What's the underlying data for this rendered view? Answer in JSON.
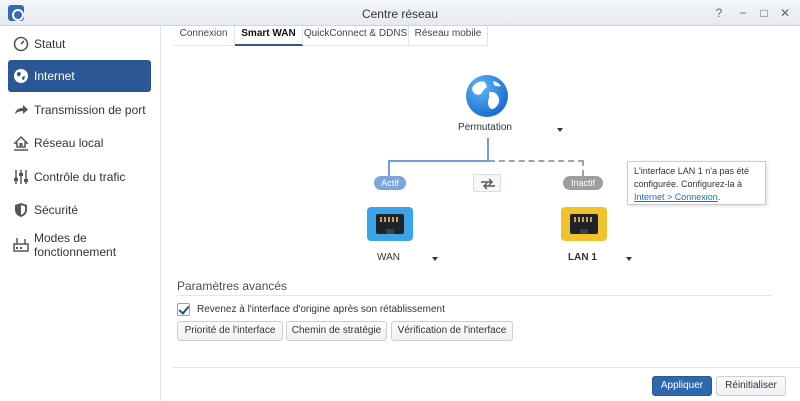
{
  "window": {
    "title": "Centre réseau",
    "help_glyph": "?",
    "minimize_glyph": "−",
    "maximize_glyph": "□",
    "close_glyph": "✕"
  },
  "sidebar": {
    "items": [
      {
        "label": "Statut",
        "icon": "gauge-icon",
        "active": false
      },
      {
        "label": "Internet",
        "icon": "globe-icon",
        "active": true
      },
      {
        "label": "Transmission de port",
        "icon": "arrow-forward-icon",
        "active": false
      },
      {
        "label": "Réseau local",
        "icon": "house-network-icon",
        "active": false
      },
      {
        "label": "Contrôle du trafic",
        "icon": "sliders-icon",
        "active": false
      },
      {
        "label": "Sécurité",
        "icon": "shield-icon",
        "active": false
      },
      {
        "label": "Modes de fonctionnement",
        "icon": "modes-icon",
        "active": false
      }
    ]
  },
  "tabs": [
    {
      "label": "Connexion",
      "active": false
    },
    {
      "label": "Smart WAN",
      "active": true
    },
    {
      "label": "QuickConnect & DDNS",
      "active": false
    },
    {
      "label": "Réseau mobile",
      "active": false
    }
  ],
  "diagram": {
    "mode_label": "Permutation",
    "left": {
      "status": "Actif",
      "interface": "WAN"
    },
    "right": {
      "status": "Inactif",
      "interface": "LAN 1"
    },
    "tooltip": {
      "text": "L'interface LAN 1 n'a pas été configurée. Configurez-la à ",
      "link": "Internet > Connexion",
      "suffix": "."
    }
  },
  "advanced": {
    "title": "Paramètres avancés",
    "checkbox_label": "Revenez à l'interface d'origine après son rétablissement",
    "checkbox_checked": true,
    "buttons": [
      "Priorité de l'interface",
      "Chemin de stratégie",
      "Vérification de l'interface"
    ]
  },
  "footer": {
    "apply": "Appliquer",
    "reset": "Réinitialiser"
  },
  "colors": {
    "accent": "#2b5894",
    "wan_port": "#3aa4e6",
    "lan_port": "#f2c12e",
    "active_pill": "#7ba5db",
    "inactive_pill": "#9e9e9e"
  }
}
